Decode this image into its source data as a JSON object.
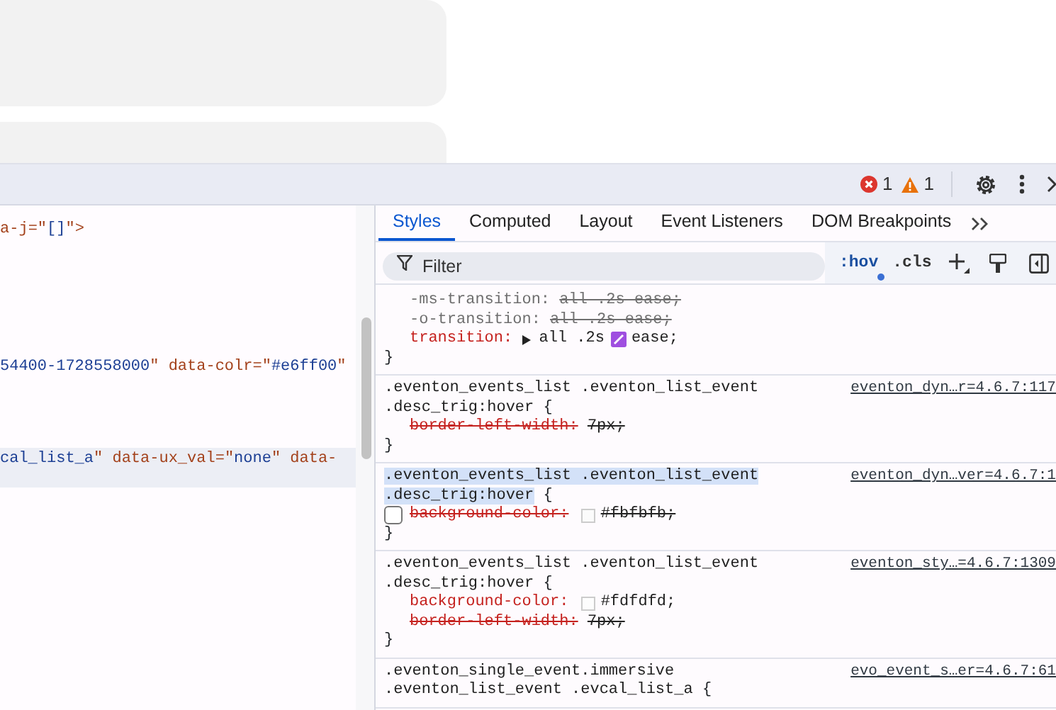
{
  "toolbar": {
    "errors": "1",
    "warnings": "1"
  },
  "elements": {
    "lines": [
      {
        "selected": false,
        "tokens": [
          {
            "kind": "name",
            "text": "a-j"
          },
          {
            "kind": "punct",
            "text": "=\""
          },
          {
            "kind": "value",
            "text": "[]"
          },
          {
            "kind": "punct",
            "text": "\">"
          }
        ]
      },
      {
        "selected": false,
        "tokens": [
          {
            "kind": "value",
            "text": "54400-1728558000"
          },
          {
            "kind": "punct",
            "text": "\" "
          },
          {
            "kind": "name",
            "text": "data-colr"
          },
          {
            "kind": "punct",
            "text": "=\""
          },
          {
            "kind": "value",
            "text": "#e6ff00"
          },
          {
            "kind": "punct",
            "text": "\""
          }
        ]
      },
      {
        "selected": true,
        "tokens": [
          {
            "kind": "value",
            "text": "cal_list_a"
          },
          {
            "kind": "punct",
            "text": "\" "
          },
          {
            "kind": "name",
            "text": "data-ux_val"
          },
          {
            "kind": "punct",
            "text": "=\""
          },
          {
            "kind": "value",
            "text": "none"
          },
          {
            "kind": "punct",
            "text": "\" "
          },
          {
            "kind": "name",
            "text": "data-"
          }
        ]
      }
    ]
  },
  "styles": {
    "tabs": [
      {
        "label": "Styles",
        "selected": true
      },
      {
        "label": "Computed",
        "selected": false
      },
      {
        "label": "Layout",
        "selected": false
      },
      {
        "label": "Event Listeners",
        "selected": false
      },
      {
        "label": "DOM Breakpoints",
        "selected": false
      }
    ],
    "filter": {
      "placeholder": "Filter"
    },
    "buttons": [
      {
        "label": ":hov",
        "indicator": true
      },
      {
        "label": ".cls",
        "indicator": false
      }
    ],
    "rules": [
      {
        "close": "}",
        "decls": [
          {
            "prop": "-ms-transition:",
            "inactive": true,
            "overridden": false,
            "enabled": true,
            "parts": [
              {
                "kind": "text",
                "text": "all .2s ease;"
              }
            ]
          },
          {
            "prop": "-o-transition:",
            "inactive": true,
            "overridden": false,
            "enabled": true,
            "parts": [
              {
                "kind": "text",
                "text": "all .2s ease;"
              }
            ]
          },
          {
            "prop": "transition:",
            "inactive": false,
            "overridden": false,
            "enabled": true,
            "parts": [
              {
                "kind": "expander"
              },
              {
                "kind": "text",
                "text": "all .2s"
              },
              {
                "kind": "easing-swatch"
              },
              {
                "kind": "text",
                "text": "ease;"
              }
            ]
          }
        ]
      },
      {
        "selector": [
          ".eventon_events_list .eventon_list_event",
          ".desc_trig:hover"
        ],
        "open": "{",
        "highlighted": false,
        "source": "eventon_dyn…r=4.6.7:117",
        "close": "}",
        "decls": [
          {
            "prop": "border-left-width:",
            "inactive": false,
            "overridden": true,
            "enabled": true,
            "parts": [
              {
                "kind": "text",
                "text": "7px;"
              }
            ]
          }
        ]
      },
      {
        "selector": [
          ".eventon_events_list .eventon_list_event",
          ".desc_trig:hover"
        ],
        "open": "{",
        "highlighted": true,
        "source": "eventon_dyn…ver=4.6.7:1",
        "close": "}",
        "decls": [
          {
            "prop": "background-color:",
            "inactive": false,
            "overridden": true,
            "enabled": false,
            "parts": [
              {
                "kind": "color-swatch",
                "color": "#fbfbfb"
              },
              {
                "kind": "text",
                "text": "#fbfbfb;"
              }
            ]
          }
        ]
      },
      {
        "selector": [
          ".eventon_events_list .eventon_list_event",
          ".desc_trig:hover"
        ],
        "open": "{",
        "highlighted": false,
        "source": "eventon_sty…=4.6.7:1309",
        "close": "}",
        "decls": [
          {
            "prop": "background-color:",
            "inactive": false,
            "overridden": false,
            "enabled": true,
            "parts": [
              {
                "kind": "color-swatch",
                "color": "#fdfdfd"
              },
              {
                "kind": "text",
                "text": "#fdfdfd;"
              }
            ]
          },
          {
            "prop": "border-left-width:",
            "inactive": false,
            "overridden": true,
            "enabled": true,
            "parts": [
              {
                "kind": "text",
                "text": "7px;"
              }
            ]
          }
        ]
      },
      {
        "selector": [
          ".eventon_single_event.immersive",
          ".eventon_list_event .evcal_list_a"
        ],
        "open": "{",
        "highlighted": false,
        "source": "evo_event_s…er=4.6.7:61"
      }
    ]
  }
}
